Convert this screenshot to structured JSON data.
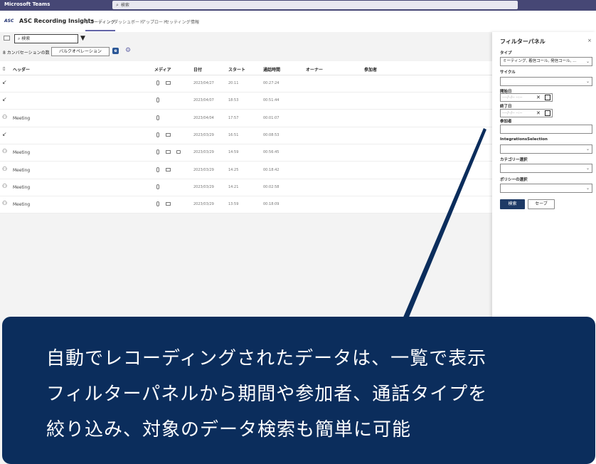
{
  "teams": {
    "app_name": "Microsoft Teams",
    "search_placeholder": "検索"
  },
  "app": {
    "logo": "ASC",
    "title": "ASC Recording Insights",
    "tabs": [
      "レコーディング",
      "ダッシュボード",
      "アップロード",
      "セッティング",
      "情報"
    ],
    "active_tab": "レコーディング"
  },
  "toolbar": {
    "search_placeholder": "検索",
    "conversation_count": "8 カンバセーションの数",
    "bulk_button": "バルクオペレーション"
  },
  "table": {
    "headers": {
      "title": "ヘッダー",
      "media": "メディア",
      "date": "日付",
      "start": "スタート",
      "duration": "通話時間",
      "owner": "オーナー",
      "participants": "参加者"
    },
    "rows": [
      {
        "type_icon": "↙",
        "title": "",
        "media": [
          "mic",
          "screen"
        ],
        "date": "2023/04/27",
        "start": "20:11",
        "duration": "00:27:24"
      },
      {
        "type_icon": "↙",
        "title": "",
        "media": [
          "mic"
        ],
        "date": "2023/04/07",
        "start": "18:53",
        "duration": "00:51:44"
      },
      {
        "type_icon": "⚇",
        "title": "Meeting",
        "media": [
          "mic"
        ],
        "date": "2023/04/04",
        "start": "17:57",
        "duration": "00:01:07"
      },
      {
        "type_icon": "↙",
        "title": "",
        "media": [
          "mic",
          "screen"
        ],
        "date": "2023/03/29",
        "start": "16:51",
        "duration": "00:08:53"
      },
      {
        "type_icon": "⚇",
        "title": "Meeting",
        "media": [
          "mic",
          "screen",
          "camera"
        ],
        "date": "2023/03/29",
        "start": "14:59",
        "duration": "00:56:45"
      },
      {
        "type_icon": "⚇",
        "title": "Meeting",
        "media": [
          "mic",
          "screen"
        ],
        "date": "2023/03/29",
        "start": "14:25",
        "duration": "00:18:42"
      },
      {
        "type_icon": "⚇",
        "title": "Meeting",
        "media": [
          "mic"
        ],
        "date": "2023/03/29",
        "start": "14:21",
        "duration": "00:02:58"
      },
      {
        "type_icon": "⚇",
        "title": "Meeting",
        "media": [
          "mic",
          "screen"
        ],
        "date": "2023/03/29",
        "start": "13:59",
        "duration": "00:18:09"
      }
    ]
  },
  "filter_panel": {
    "title": "フィルターパネル",
    "close_icon": "×",
    "type_label": "タイプ",
    "type_value": "ミーティング, 着信コール, 発信コール, ...",
    "cycle_label": "サイクル",
    "start_date_label": "開始日",
    "end_date_label": "終了日",
    "date_placeholder": "----/--/-- --:--",
    "participants_label": "参加者",
    "integrations_label": "IntegrationsSelection",
    "category_label": "カテゴリー選択",
    "policy_label": "ポリシーの選択",
    "search_button": "検索",
    "save_button": "セーブ"
  },
  "callout": {
    "lines": [
      "自動でレコーディングされたデータは、一覧で表示",
      "フィルターパネルから期間や参加者、通話タイプを",
      "絞り込み、対象のデータ検索も簡単に可能"
    ]
  },
  "colors": {
    "teams_bar": "#464775",
    "accent": "#6264a7",
    "callout_bg": "#0b2d5c",
    "primary_button": "#1e3a66"
  }
}
